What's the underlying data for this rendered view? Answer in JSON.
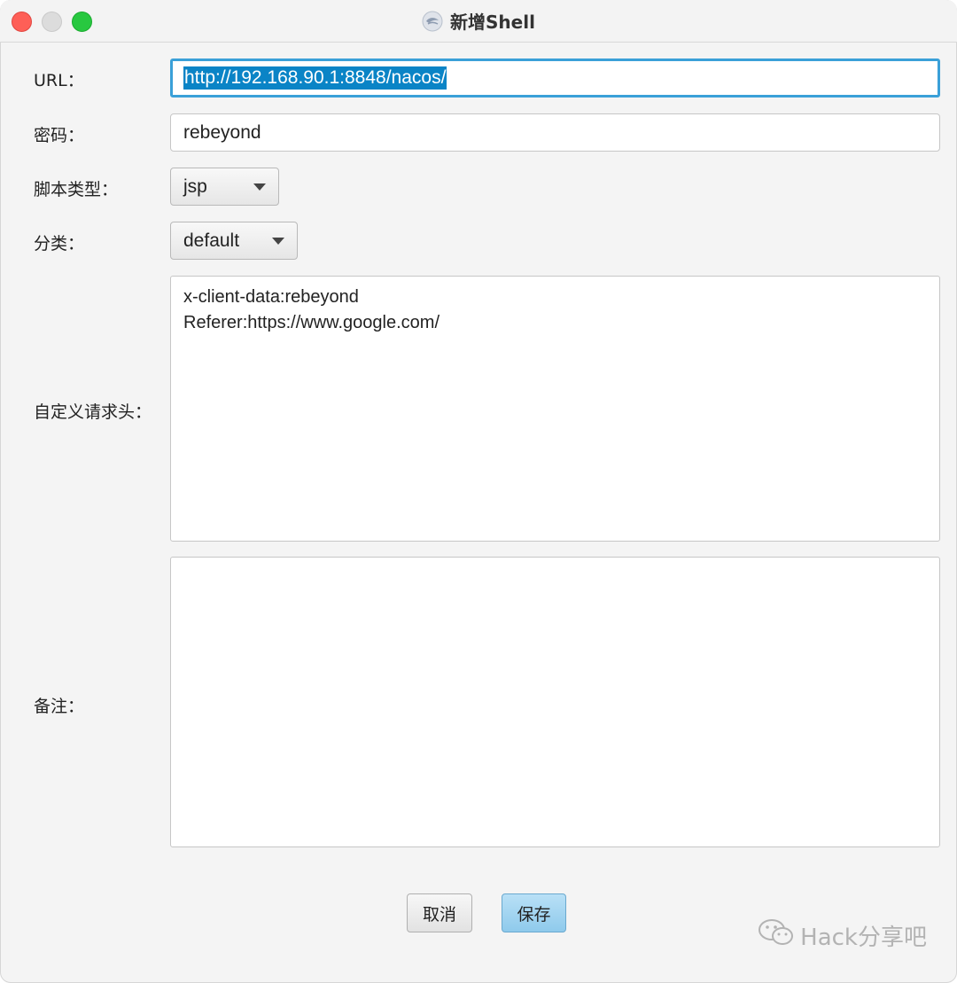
{
  "window": {
    "title": "新增Shell"
  },
  "form": {
    "url_label": "URL：",
    "url_value": "http://192.168.90.1:8848/nacos/",
    "password_label": "密码：",
    "password_value": "rebeyond",
    "script_type_label": "脚本类型：",
    "script_type_value": "jsp",
    "category_label": "分类：",
    "category_value": "default",
    "headers_label": "自定义请求头：",
    "headers_lines": [
      "x-client-data:rebeyond",
      "Referer:https://www.google.com/"
    ],
    "notes_label": "备注：",
    "notes_value": ""
  },
  "buttons": {
    "cancel": "取消",
    "save": "保存"
  },
  "watermark": {
    "text": "Hack分享吧"
  },
  "colors": {
    "selection": "#0a84c6",
    "focus_ring": "#3aa0d8",
    "primary_button": "#9fd3ef"
  }
}
